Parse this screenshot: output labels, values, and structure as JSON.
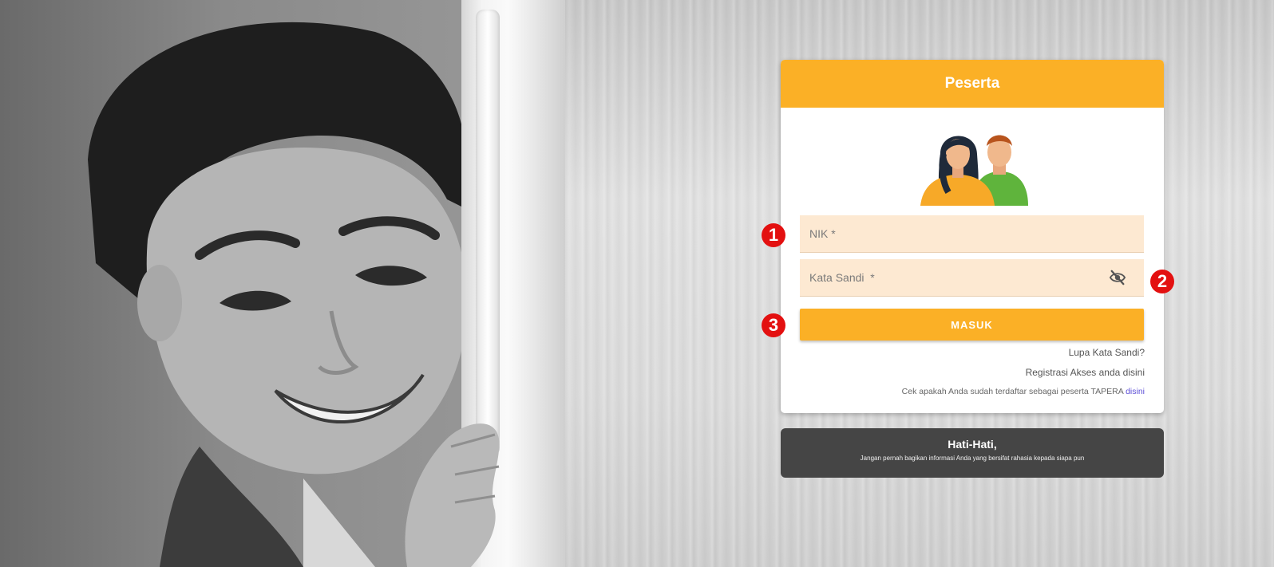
{
  "card": {
    "title": "Peserta",
    "nik_placeholder": "NIK *",
    "password_placeholder": "Kata Sandi  *",
    "login_button": "MASUK",
    "forgot_link": "Lupa Kata Sandi?",
    "register_link": "Registrasi Akses anda disini",
    "check_text": "Cek apakah Anda sudah terdaftar sebagai peserta TAPERA",
    "check_link": "disini",
    "avatar_icon": "people-avatar-icon",
    "visibility_icon": "eye-slash-icon"
  },
  "warning": {
    "title": "Hati-Hati,",
    "text": "Jangan pernah bagikan informasi Anda yang bersifat rahasia kepada siapa pun"
  },
  "markers": [
    "1",
    "2",
    "3"
  ],
  "colors": {
    "accent": "#fbb026",
    "input_bg": "#fde9d2",
    "warning_bg": "#454545",
    "marker": "#e31010",
    "link": "#5b4dd6"
  }
}
